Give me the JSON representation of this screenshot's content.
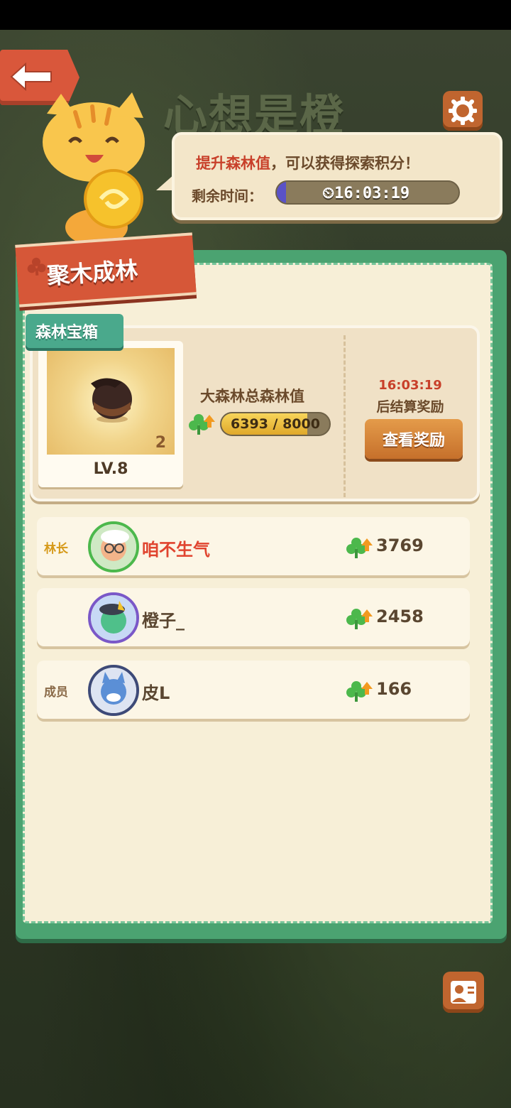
{
  "header": {
    "title": "心想是橙",
    "back_icon": "back-arrow-icon",
    "settings_icon": "gear-icon"
  },
  "speech": {
    "highlight": "提升森林值",
    "message": "，可以获得探索积分！",
    "remaining_label": "剩余时间：",
    "remaining_time": "16:03:19",
    "remaining_progress": 0.05
  },
  "panel": {
    "banner": "聚木成林",
    "chest_tab": "森林宝箱",
    "chest": {
      "count": "2",
      "level": "LV.8"
    },
    "forest": {
      "label": "大森林总森林值",
      "value_text": "6393 / 8000",
      "current": 6393,
      "max": 8000
    },
    "settlement": {
      "time": "16:03:19",
      "label": "后结算奖励",
      "button": "查看奖励"
    }
  },
  "members": [
    {
      "role": "林长",
      "name": "咱不生气",
      "score": "3769",
      "is_leader": true
    },
    {
      "role": "",
      "name": "橙子_",
      "score": "2458",
      "is_leader": false
    },
    {
      "role": "成员",
      "name": "皮L",
      "score": "166",
      "is_leader": false
    }
  ],
  "colors": {
    "accent_red": "#d65738",
    "panel_green": "#4ba371",
    "text_brown": "#6b4a2b",
    "highlight_red": "#c8402a"
  }
}
